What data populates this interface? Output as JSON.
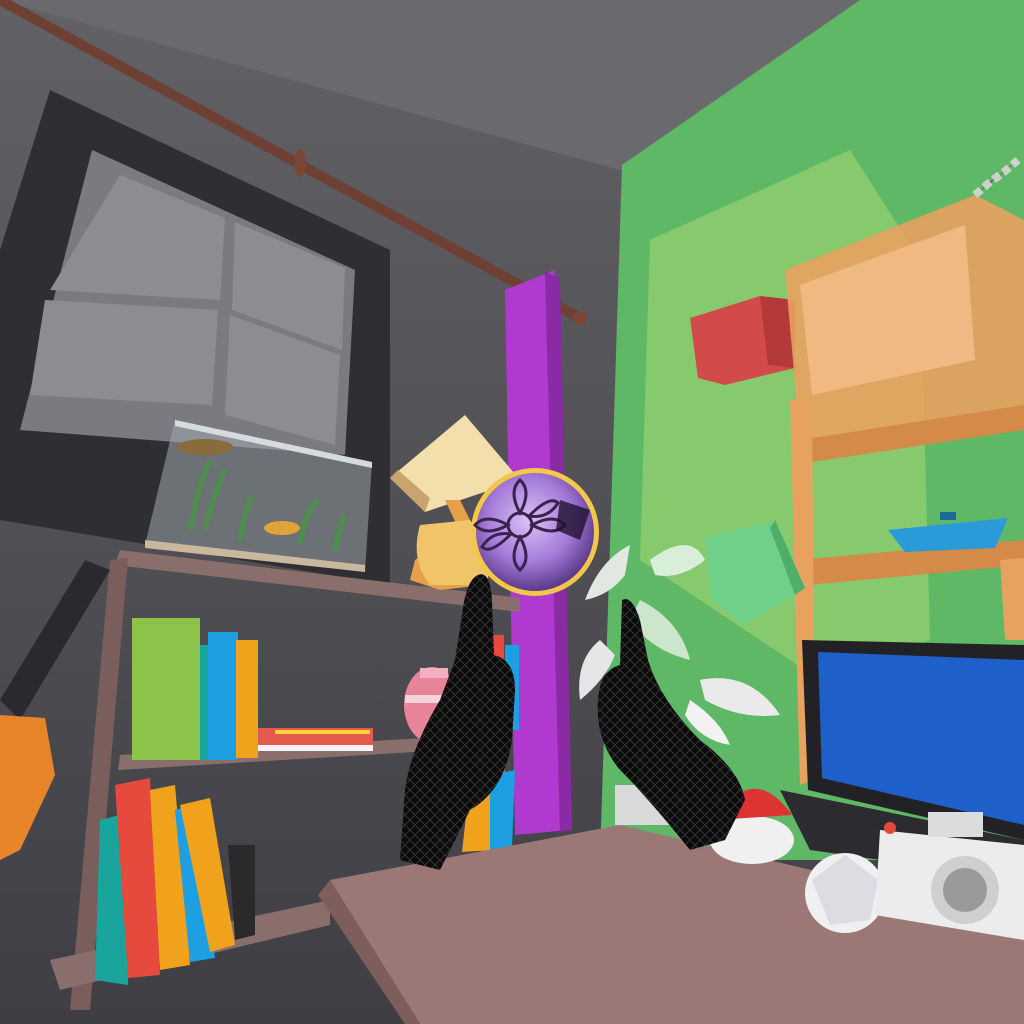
{
  "scene": {
    "type": "vr-room",
    "objects": [
      "window",
      "curtain-rod",
      "aquarium",
      "bookshelf",
      "books",
      "guitar",
      "lamp",
      "vase",
      "purple-pillar",
      "patterned-ball",
      "plant",
      "green-cube",
      "red-cube",
      "wall-shelf",
      "toy-boat",
      "laptop",
      "camera",
      "red-button",
      "white-ball",
      "table",
      "hand-left",
      "hand-right"
    ]
  },
  "colors": {
    "wall_gray": "#5f5f62",
    "wall_green": "#5fb865",
    "pillar_purple": "#b03ad0",
    "table": "#9b7775",
    "shelf_wood": "#8a6e6b",
    "wall_shelf": "#e8a25f",
    "laptop_screen": "#1f5fc9",
    "ball_purple": "#b98be6",
    "hands": "#0a0a0a"
  }
}
